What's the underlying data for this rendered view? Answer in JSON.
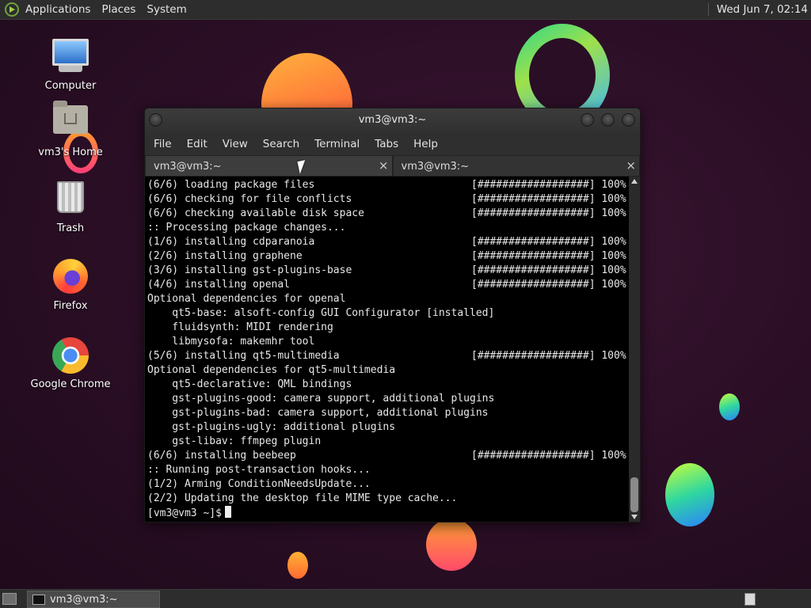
{
  "top_panel": {
    "menus": [
      "Applications",
      "Places",
      "System"
    ],
    "clock": "Wed Jun  7, 02:14"
  },
  "desktop_icons": [
    {
      "label": "Computer",
      "icon": "computer-icon"
    },
    {
      "label": "vm3's Home",
      "icon": "home-folder-icon"
    },
    {
      "label": "Trash",
      "icon": "trash-icon"
    },
    {
      "label": "Firefox",
      "icon": "firefox-icon"
    },
    {
      "label": "Google Chrome",
      "icon": "chrome-icon"
    }
  ],
  "terminal": {
    "title": "vm3@vm3:~",
    "menu": [
      "File",
      "Edit",
      "View",
      "Search",
      "Terminal",
      "Tabs",
      "Help"
    ],
    "tabs": [
      {
        "label": "vm3@vm3:~",
        "close": "×"
      },
      {
        "label": "vm3@vm3:~",
        "close": "×"
      }
    ],
    "lines": [
      {
        "text": "(6/6) loading package files",
        "progress": "[##################] 100%"
      },
      {
        "text": "(6/6) checking for file conflicts",
        "progress": "[##################] 100%"
      },
      {
        "text": "(6/6) checking available disk space",
        "progress": "[##################] 100%"
      },
      {
        "text": ":: Processing package changes...",
        "progress": ""
      },
      {
        "text": "(1/6) installing cdparanoia",
        "progress": "[##################] 100%"
      },
      {
        "text": "(2/6) installing graphene",
        "progress": "[##################] 100%"
      },
      {
        "text": "(3/6) installing gst-plugins-base",
        "progress": "[##################] 100%"
      },
      {
        "text": "(4/6) installing openal",
        "progress": "[##################] 100%"
      },
      {
        "text": "Optional dependencies for openal",
        "progress": ""
      },
      {
        "text": "    qt5-base: alsoft-config GUI Configurator [installed]",
        "progress": ""
      },
      {
        "text": "    fluidsynth: MIDI rendering",
        "progress": ""
      },
      {
        "text": "    libmysofa: makemhr tool",
        "progress": ""
      },
      {
        "text": "(5/6) installing qt5-multimedia",
        "progress": "[##################] 100%"
      },
      {
        "text": "Optional dependencies for qt5-multimedia",
        "progress": ""
      },
      {
        "text": "    qt5-declarative: QML bindings",
        "progress": ""
      },
      {
        "text": "    gst-plugins-good: camera support, additional plugins",
        "progress": ""
      },
      {
        "text": "    gst-plugins-bad: camera support, additional plugins",
        "progress": ""
      },
      {
        "text": "    gst-plugins-ugly: additional plugins",
        "progress": ""
      },
      {
        "text": "    gst-libav: ffmpeg plugin",
        "progress": ""
      },
      {
        "text": "(6/6) installing beebeep",
        "progress": "[##################] 100%"
      },
      {
        "text": ":: Running post-transaction hooks...",
        "progress": ""
      },
      {
        "text": "(1/2) Arming ConditionNeedsUpdate...",
        "progress": ""
      },
      {
        "text": "(2/2) Updating the desktop file MIME type cache...",
        "progress": ""
      }
    ],
    "prompt": "[vm3@vm3 ~]$"
  },
  "bottom_panel": {
    "task_label": "vm3@vm3:~"
  }
}
